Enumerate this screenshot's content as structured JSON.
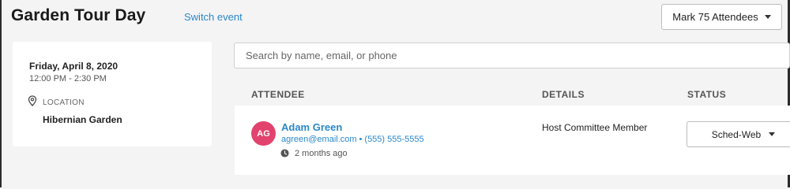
{
  "header": {
    "event_title": "Garden Tour Day",
    "switch_event_label": "Switch event",
    "mark_attendees_label": "Mark 75 Attendees"
  },
  "event": {
    "date": "Friday, April 8, 2020",
    "time": "12:00 PM - 2:30 PM",
    "location_label": "LOCATION",
    "location_name": "Hibernian Garden"
  },
  "search": {
    "placeholder": "Search by name, email, or phone",
    "value": ""
  },
  "table": {
    "columns": [
      "ATTENDEE",
      "DETAILS",
      "STATUS"
    ],
    "rows": [
      {
        "initials": "AG",
        "name": "Adam Green",
        "email": "agreen@email.com",
        "separator": "•",
        "phone": "(555) 555-5555",
        "time_ago": "2 months ago",
        "details": "Host Committee Member",
        "status": "Sched-Web"
      }
    ]
  },
  "colors": {
    "accent": "#2a88c8",
    "avatar_bg": "#e2436e",
    "page_bg": "#f4f4f5"
  },
  "icons": {
    "location": "map-pin-icon",
    "clock": "clock-icon",
    "caret": "caret-down-icon"
  }
}
